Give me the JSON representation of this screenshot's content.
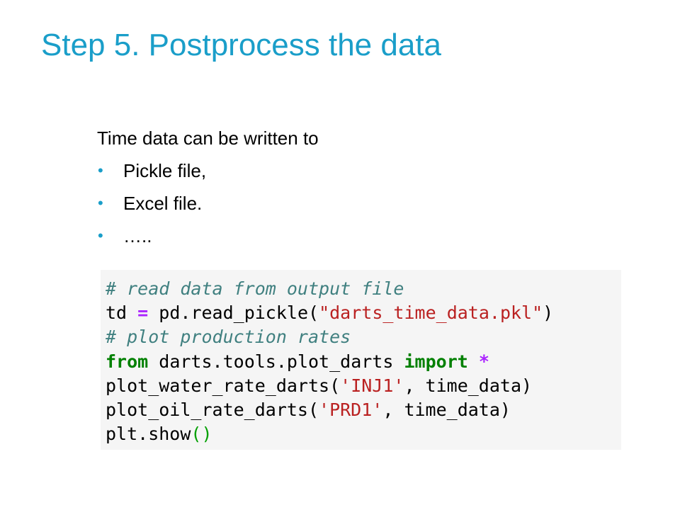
{
  "slide": {
    "title": "Step 5. Postprocess the data",
    "intro": "Time data can be written to",
    "bullets": [
      {
        "text": "Pickle file,"
      },
      {
        "text": "Excel file."
      },
      {
        "text": "….."
      }
    ],
    "bullet_symbol": "•"
  },
  "code": {
    "line1_comment": "# read data from output file",
    "line2_var": "td",
    "line2_op": "=",
    "line2_call": "pd.read_pickle(",
    "line2_str": "\"darts_time_data.pkl\"",
    "line2_close": ")",
    "line3_comment": "# plot production rates",
    "line4_from": "from",
    "line4_module": "darts.tools.plot_darts",
    "line4_import": "import",
    "line4_star": "*",
    "line5_call": "plot_water_rate_darts(",
    "line5_str": "'INJ1'",
    "line5_rest": ", time_data)",
    "line6_call": "plot_oil_rate_darts(",
    "line6_str": "'PRD1'",
    "line6_rest": ", time_data)",
    "line7_call": "plt.show",
    "line7_parens": "()"
  },
  "colors": {
    "title": "#1a9ec9",
    "bullet": "#1a9ec9",
    "code_background": "#f5f5f5",
    "comment": "#408080",
    "keyword": "#008000",
    "string": "#ba2121",
    "operator": "#aa22ff"
  }
}
